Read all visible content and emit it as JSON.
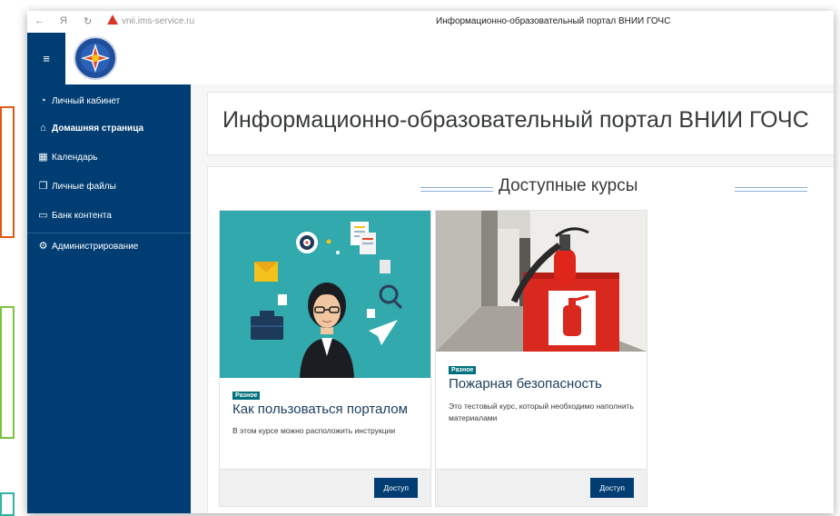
{
  "browser": {
    "url": "vnii.ims-service.ru",
    "tab_title": "Информационно-образовательный портал ВНИИ ГОЧС",
    "back_icon": "back-arrow-icon",
    "yandex_icon": "yandex-icon",
    "reload_icon": "reload-icon"
  },
  "header": {
    "menu_icon": "hamburger-icon",
    "logo": "mchs-emblem"
  },
  "sidebar": {
    "items": [
      {
        "label": "Личный кабинет",
        "icon": "dashboard-icon"
      },
      {
        "label": "Домашняя страница",
        "icon": "home-icon"
      },
      {
        "label": "Календарь",
        "icon": "calendar-icon"
      },
      {
        "label": "Личные файлы",
        "icon": "files-icon"
      },
      {
        "label": "Банк контента",
        "icon": "folder-icon"
      },
      {
        "label": "Администрирование",
        "icon": "gear-icon"
      }
    ]
  },
  "main": {
    "page_title": "Информационно-образовательный портал ВНИИ ГОЧС",
    "section_title": "Доступные курсы",
    "courses": [
      {
        "category": "Разное",
        "title": "Как пользоваться порталом",
        "description": "В этом курсе можно расположить инструкции",
        "button": "Доступ"
      },
      {
        "category": "Разное",
        "title": "Пожарная безопасность",
        "description": "Это тестовый курс, который необходимо наполнить материалами",
        "button": "Доступ"
      }
    ]
  },
  "colors": {
    "sidebar": "#003d73",
    "badge": "#00707e",
    "button": "#003d73",
    "highlight_orange": "#e05a14",
    "highlight_green": "#7cc43a"
  }
}
